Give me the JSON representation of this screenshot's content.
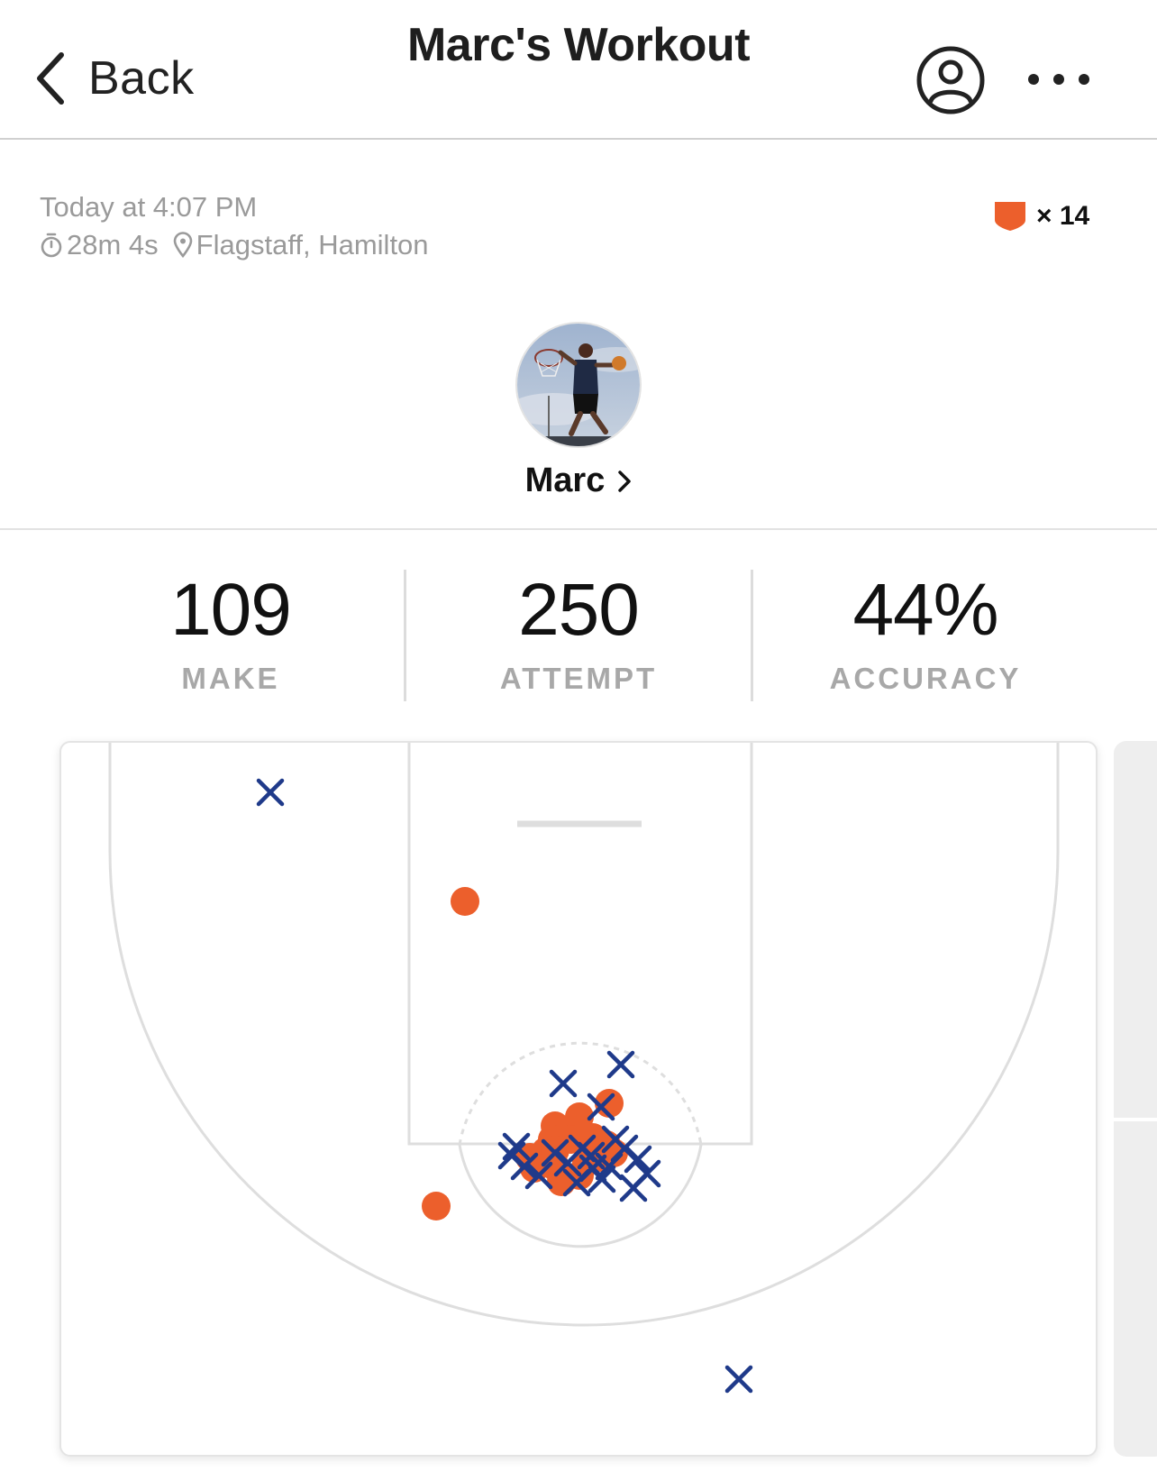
{
  "header": {
    "back_label": "Back",
    "title": "Marc's Workout"
  },
  "meta": {
    "date": "Today at 4:07 PM",
    "duration": "28m 4s",
    "location": "Flagstaff, Hamilton"
  },
  "badge": {
    "text": "× 14",
    "color": "#ec5f2c"
  },
  "player": {
    "name": "Marc"
  },
  "stats": [
    {
      "value": "109",
      "label": "MAKE"
    },
    {
      "value": "250",
      "label": "ATTEMPT"
    },
    {
      "value": "44%",
      "label": "ACCURACY"
    }
  ],
  "colors": {
    "make": "#ec5f2c",
    "miss": "#1f3a8a",
    "court_lines": "#dedede"
  },
  "icons": {
    "back": "chevron-left-icon",
    "profile": "user-circle-icon",
    "more": "more-horizontal-icon",
    "timer": "stopwatch-icon",
    "location": "location-pin-icon",
    "badge": "shield-icon",
    "player_link": "chevron-right-icon"
  }
}
